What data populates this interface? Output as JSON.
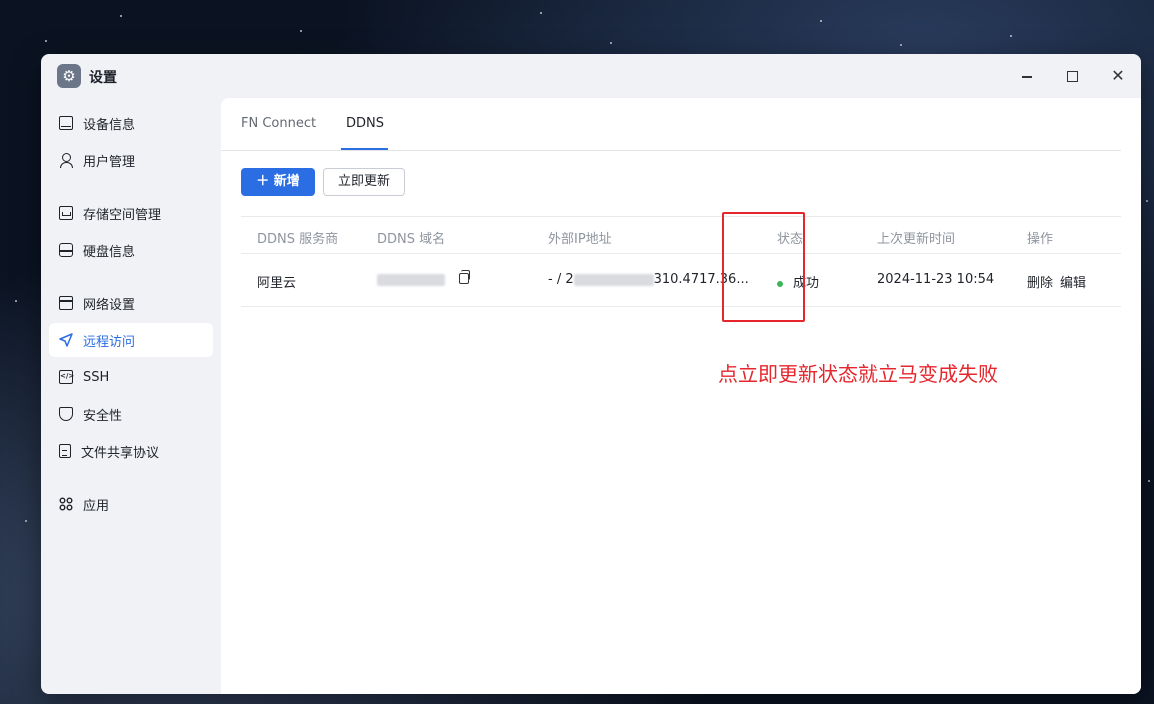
{
  "window": {
    "title": "设置",
    "controls": {
      "minimize": "minimize-icon",
      "maximize": "maximize-icon",
      "close": "✕"
    }
  },
  "sidebar": {
    "items": [
      {
        "label": "设备信息",
        "icon": "device-icon"
      },
      {
        "label": "用户管理",
        "icon": "user-icon"
      },
      {
        "label": "存储空间管理",
        "icon": "storage-icon"
      },
      {
        "label": "硬盘信息",
        "icon": "disk-icon"
      },
      {
        "label": "网络设置",
        "icon": "network-icon"
      },
      {
        "label": "远程访问",
        "icon": "send-icon",
        "active": true
      },
      {
        "label": "SSH",
        "icon": "ssh-icon",
        "icon_text": "</>"
      },
      {
        "label": "安全性",
        "icon": "shield-icon"
      },
      {
        "label": "文件共享协议",
        "icon": "document-icon"
      },
      {
        "label": "应用",
        "icon": "apps-icon"
      }
    ]
  },
  "tabs": [
    {
      "label": "FN Connect"
    },
    {
      "label": "DDNS",
      "active": true
    }
  ],
  "toolbar": {
    "add_label": "＋ 新增",
    "update_now_label": "立即更新"
  },
  "table": {
    "headers": [
      "DDNS 服务商",
      "DDNS 域名",
      "外部IP地址",
      "状态",
      "上次更新时间",
      "操作"
    ],
    "rows": [
      {
        "provider": "阿里云",
        "domain": "",
        "ip_prefix": "- / 2",
        "ip_suffix": "310.4717.36...",
        "status": "成功",
        "last_update": "2024-11-23 10:54",
        "actions": [
          "删除",
          "编辑"
        ]
      }
    ]
  },
  "annotation": {
    "text": "点立即更新状态就立马变成失败",
    "color": "#e5262d"
  },
  "colors": {
    "accent": "#2b6de3",
    "success": "#3fb45a",
    "sidebar_bg": "#f0f2f6"
  }
}
